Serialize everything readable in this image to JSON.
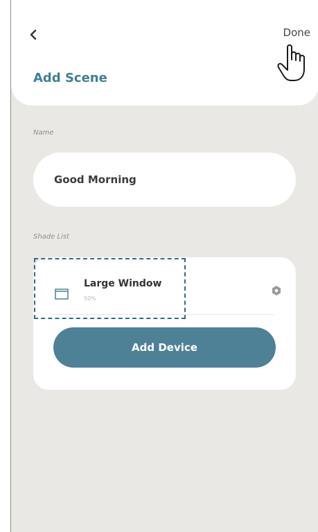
{
  "header": {
    "done_label": "Done",
    "title": "Add Scene"
  },
  "name_section": {
    "label": "Name",
    "value": "Good Morning"
  },
  "shade_section": {
    "label": "Shade List",
    "items": [
      {
        "name": "Large Window",
        "level": "50%",
        "icon": "window-shade-icon"
      }
    ],
    "add_device_label": "Add Device"
  },
  "colors": {
    "accent": "#3f7f95",
    "button": "#4e8196",
    "background": "#e9e8e4",
    "highlight_dashed": "#2d6b86"
  }
}
